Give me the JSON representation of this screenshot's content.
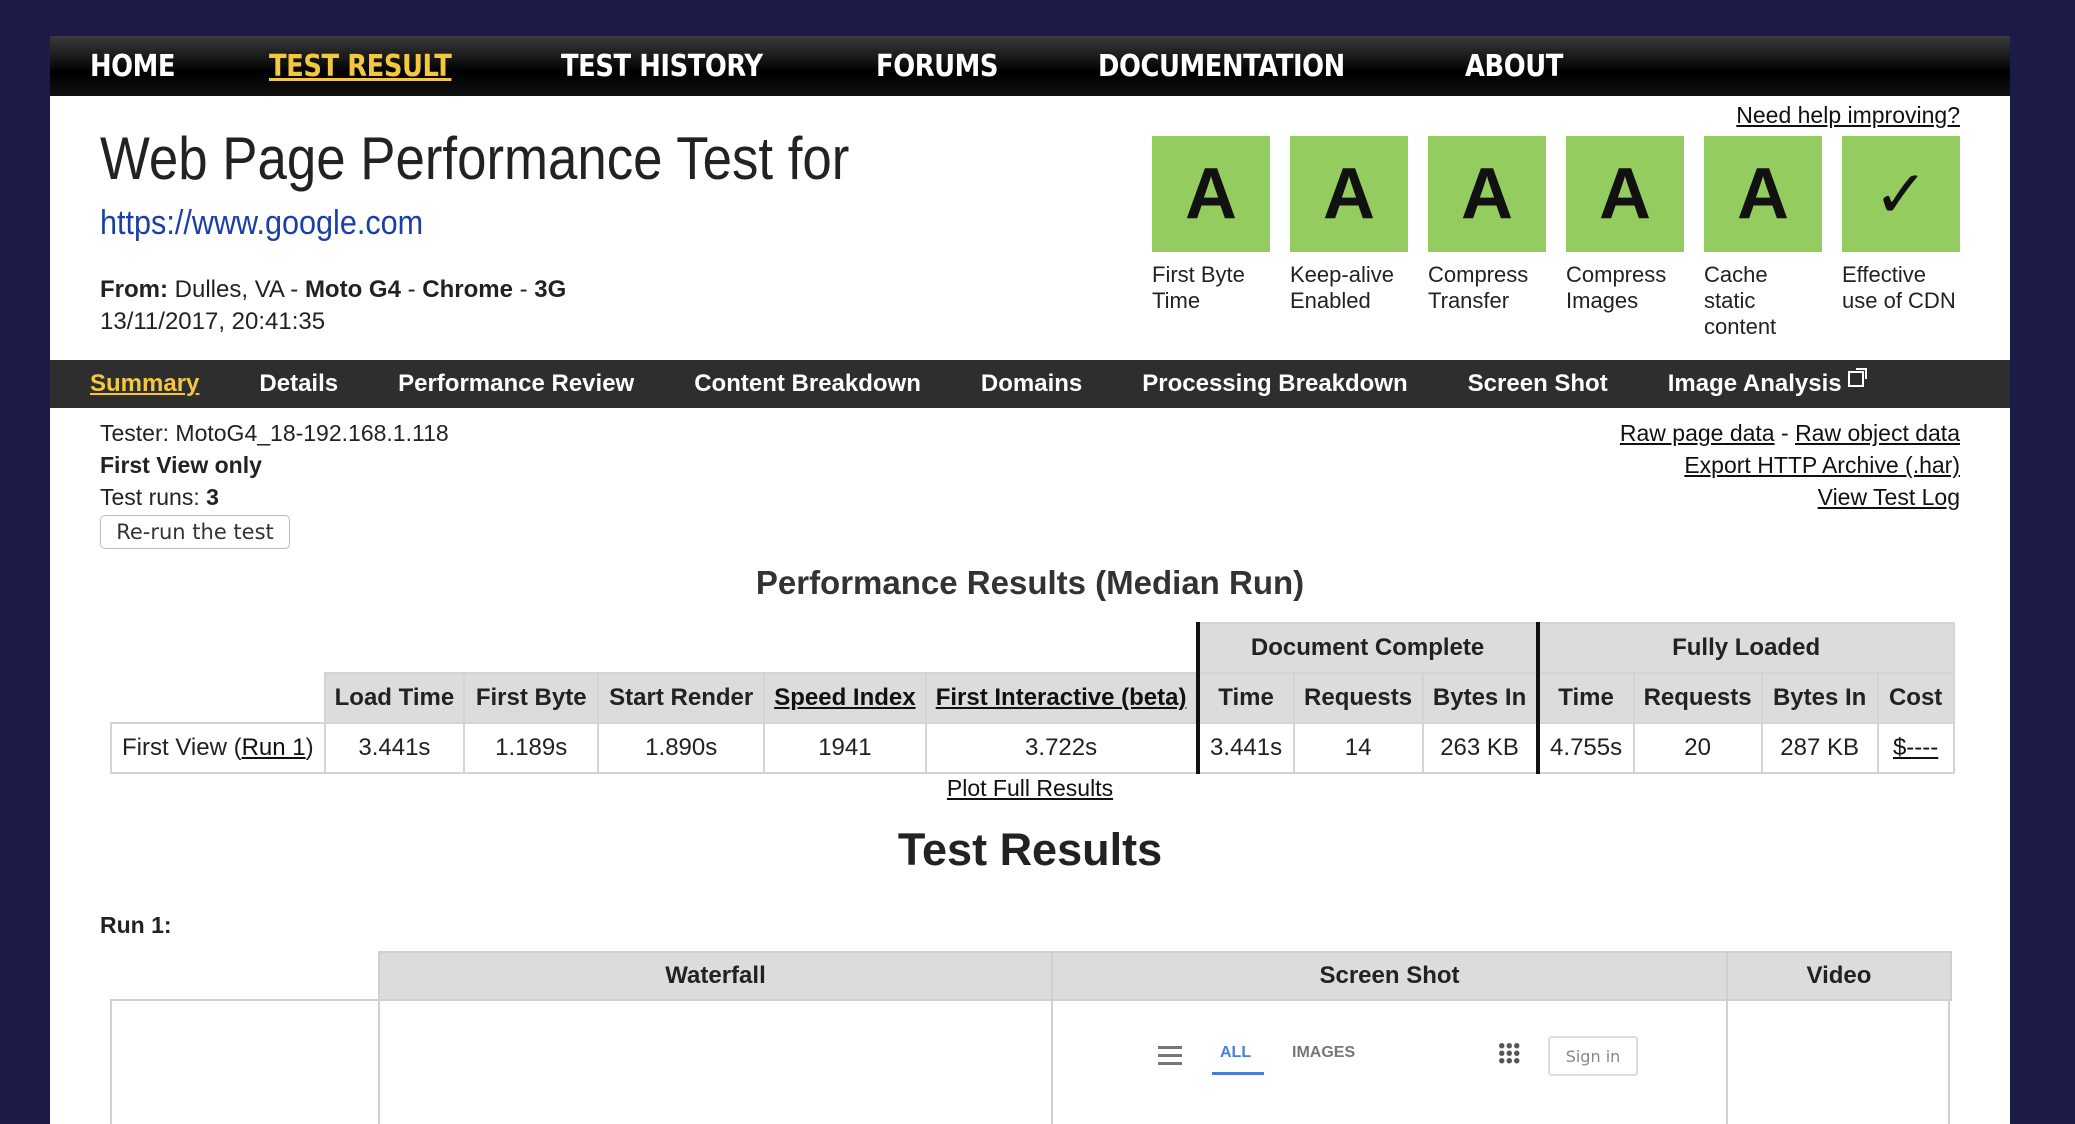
{
  "top_nav": {
    "items": [
      "HOME",
      "TEST RESULT",
      "TEST HISTORY",
      "FORUMS",
      "DOCUMENTATION",
      "ABOUT"
    ],
    "active": "TEST RESULT"
  },
  "header": {
    "title": "Web Page Performance Test for",
    "url": "https://www.google.com",
    "from_label": "From:",
    "from_location": "Dulles, VA",
    "device": "Moto G4",
    "browser": "Chrome",
    "connection": "3G",
    "datetime": "13/11/2017, 20:41:35",
    "help_link": "Need help improving?"
  },
  "grades": [
    {
      "grade": "A",
      "label": "First Byte\nTime"
    },
    {
      "grade": "A",
      "label": "Keep-alive\nEnabled"
    },
    {
      "grade": "A",
      "label": "Compress\nTransfer"
    },
    {
      "grade": "A",
      "label": "Compress\nImages"
    },
    {
      "grade": "A",
      "label": "Cache\nstatic\ncontent"
    },
    {
      "grade": "✓",
      "label": "Effective\nuse of CDN"
    }
  ],
  "grade_color": "#95cc5f",
  "sub_nav": {
    "items": [
      "Summary",
      "Details",
      "Performance Review",
      "Content Breakdown",
      "Domains",
      "Processing Breakdown",
      "Screen Shot",
      "Image Analysis"
    ],
    "active": "Summary"
  },
  "test_info": {
    "tester_label": "Tester:",
    "tester": "MotoG4_18-192.168.1.118",
    "view": "First View only",
    "runs_label": "Test runs:",
    "runs": "3",
    "rerun_button": "Re-run the test"
  },
  "side_links": {
    "raw_page": "Raw page data",
    "separator": "-",
    "raw_object": "Raw object data",
    "export_har": "Export HTTP Archive (.har)",
    "test_log": "View Test Log"
  },
  "performance": {
    "heading": "Performance Results (Median Run)",
    "group_doc": "Document Complete",
    "group_full": "Fully Loaded",
    "columns": [
      "Load Time",
      "First Byte",
      "Start Render",
      "Speed Index",
      "First Interactive (beta)",
      "Time",
      "Requests",
      "Bytes In",
      "Time",
      "Requests",
      "Bytes In",
      "Cost"
    ],
    "row_label_prefix": "First View (",
    "row_label_link": "Run 1",
    "row_label_suffix": ")",
    "values": [
      "3.441s",
      "1.189s",
      "1.890s",
      "1941",
      "3.722s",
      "3.441s",
      "14",
      "263 KB",
      "4.755s",
      "20",
      "287 KB",
      "$----"
    ],
    "plot_link": "Plot Full Results"
  },
  "test_results": {
    "heading": "Test Results",
    "run_label": "Run 1:",
    "columns": [
      "Waterfall",
      "Screen Shot",
      "Video"
    ]
  },
  "screenshot_preview": {
    "tab_all": "ALL",
    "tab_images": "IMAGES",
    "sign_in": "Sign in"
  }
}
